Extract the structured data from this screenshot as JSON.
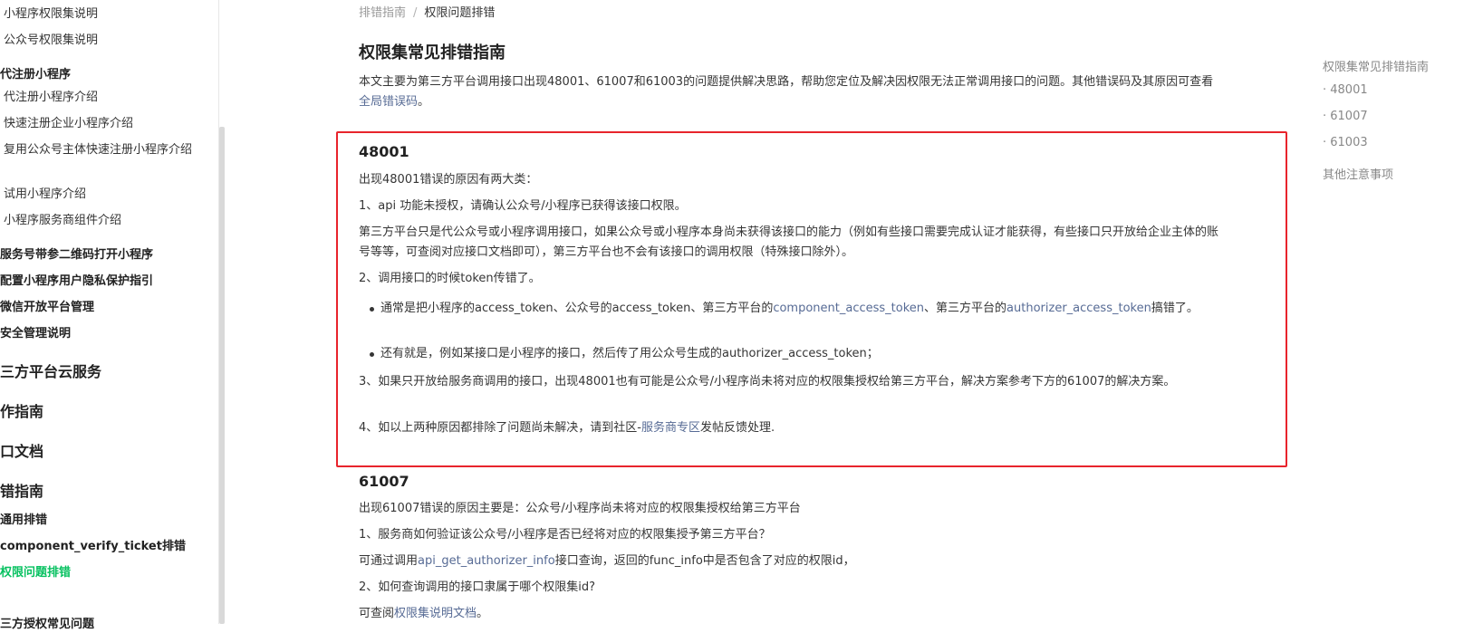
{
  "sidebar": {
    "items": [
      "小程序权限集说明",
      "公众号权限集说明",
      "代注册小程序",
      "代注册小程序介绍",
      "快速注册企业小程序介绍",
      "复用公众号主体快速注册小程序介绍",
      "试用小程序介绍",
      "小程序服务商组件介绍",
      "服务号带参二维码打开小程序",
      "配置小程序用户隐私保护指引",
      "微信开放平台管理",
      "安全管理说明",
      "三方平台云服务",
      "作指南",
      "口文档",
      "错指南",
      "通用排错",
      "component_verify_ticket排错",
      "权限问题排错",
      "三方授权常见问题"
    ]
  },
  "breadcrumb": {
    "parent": "排错指南",
    "separator": "/",
    "current": "权限问题排错"
  },
  "main": {
    "title": "权限集常见排错指南",
    "intro": "本文主要为第三方平台调用接口出现48001、61007和61003的问题提供解决思路，帮助您定位及解决因权限无法正常调用接口的问题。其他错误码及其原因可查看",
    "intro_link": "全局错误码",
    "intro_end": "。",
    "s48001": {
      "heading": "48001",
      "p1": "出现48001错误的原因有两大类：",
      "p2": "1、api 功能未授权，请确认公众号/小程序已获得该接口权限。",
      "p3": "第三方平台只是代公众号或小程序调用接口，如果公众号或小程序本身尚未获得该接口的能力（例如有些接口需要完成认证才能获得，有些接口只开放给企业主体的账号等等，可查阅对应接口文档即可），第三方平台也不会有该接口的调用权限（特殊接口除外）。",
      "p4": "2、调用接口的时候token传错了。",
      "b1_pre": "通常是把小程序的access_token、公众号的access_token、第三方平台的",
      "b1_link1": "component_access_token",
      "b1_mid": "、第三方平台的",
      "b1_link2": "authorizer_access_token",
      "b1_post": "搞错了。",
      "b2": "还有就是，例如某接口是小程序的接口，然后传了用公众号生成的authorizer_access_token；",
      "p5": "3、如果只开放给服务商调用的接口，出现48001也有可能是公众号/小程序尚未将对应的权限集授权给第三方平台，解决方案参考下方的61007的解决方案。",
      "p6_pre": "4、如以上两种原因都排除了问题尚未解决，请到社区-",
      "p6_link": "服务商专区",
      "p6_post": "发帖反馈处理."
    },
    "s61007": {
      "heading": "61007",
      "p1": "出现61007错误的原因主要是：公众号/小程序尚未将对应的权限集授权给第三方平台",
      "p2": "1、服务商如何验证该公众号/小程序是否已经将对应的权限集授予第三方平台？",
      "p3_pre": "可通过调用",
      "p3_link": "api_get_authorizer_info",
      "p3_post": "接口查询，返回的func_info中是否包含了对应的权限id，",
      "p4": "2、如何查询调用的接口隶属于哪个权限集id?",
      "p5_pre": "可查阅",
      "p5_link": "权限集说明文档",
      "p5_post": "。"
    }
  },
  "toc": [
    "权限集常见排错指南",
    "· 48001",
    "· 61007",
    "· 61003",
    "其他注意事项"
  ]
}
